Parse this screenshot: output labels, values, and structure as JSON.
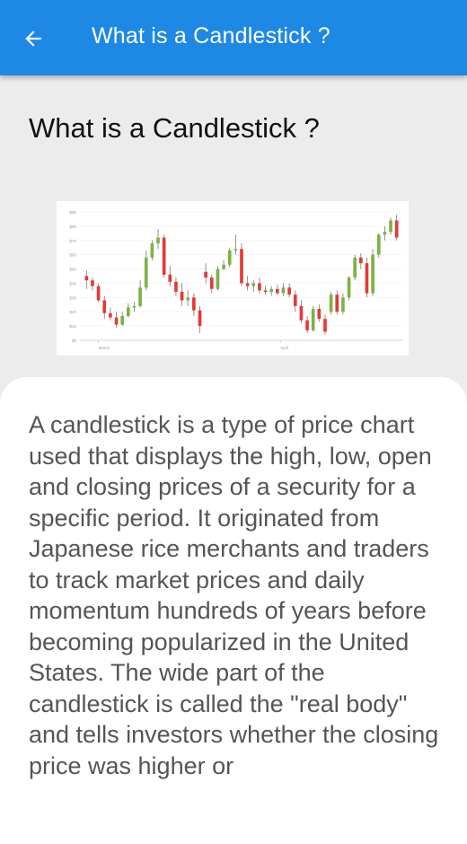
{
  "app_bar": {
    "back_icon": "arrow-back-icon",
    "title": "What is a Candlestick ?",
    "color": "#1e88e5"
  },
  "content": {
    "heading": "What is a Candlestick ?",
    "body": "A candlestick is a type of price chart used that displays the high, low, open and closing prices of a security for a specific period. It originated from Japanese rice merchants and traders to track market prices and daily momentum hundreds of years before becoming popularized in the United States. The wide part of the candlestick is called the \"real body\" and tells investors whether the closing price was higher or"
  },
  "chart_data": {
    "type": "candlestick",
    "y_ticks": [
      "$0",
      "$10",
      "$20",
      "$30",
      "$40",
      "$50",
      "$60",
      "$70",
      "$80",
      "$90"
    ],
    "x_labels": [
      "March",
      "April"
    ],
    "up_color": "#7cb342",
    "down_color": "#e53935",
    "candles": [
      {
        "o": 45,
        "h": 49,
        "l": 36,
        "c": 42
      },
      {
        "o": 42,
        "h": 44,
        "l": 35,
        "c": 38
      },
      {
        "o": 38,
        "h": 40,
        "l": 27,
        "c": 28
      },
      {
        "o": 28,
        "h": 31,
        "l": 15,
        "c": 19
      },
      {
        "o": 19,
        "h": 23,
        "l": 14,
        "c": 16
      },
      {
        "o": 16,
        "h": 20,
        "l": 9,
        "c": 11
      },
      {
        "o": 11,
        "h": 20,
        "l": 10,
        "c": 17
      },
      {
        "o": 17,
        "h": 26,
        "l": 16,
        "c": 23
      },
      {
        "o": 23,
        "h": 27,
        "l": 20,
        "c": 24
      },
      {
        "o": 24,
        "h": 42,
        "l": 23,
        "c": 37
      },
      {
        "o": 37,
        "h": 63,
        "l": 35,
        "c": 58
      },
      {
        "o": 58,
        "h": 70,
        "l": 56,
        "c": 68
      },
      {
        "o": 68,
        "h": 78,
        "l": 64,
        "c": 72
      },
      {
        "o": 72,
        "h": 74,
        "l": 44,
        "c": 46
      },
      {
        "o": 46,
        "h": 52,
        "l": 38,
        "c": 41
      },
      {
        "o": 41,
        "h": 44,
        "l": 31,
        "c": 34
      },
      {
        "o": 34,
        "h": 40,
        "l": 24,
        "c": 28
      },
      {
        "o": 28,
        "h": 35,
        "l": 24,
        "c": 30
      },
      {
        "o": 30,
        "h": 33,
        "l": 17,
        "c": 21
      },
      {
        "o": 21,
        "h": 24,
        "l": 5,
        "c": 10
      },
      {
        "o": 48,
        "h": 54,
        "l": 40,
        "c": 44
      },
      {
        "o": 44,
        "h": 46,
        "l": 33,
        "c": 36
      },
      {
        "o": 36,
        "h": 52,
        "l": 35,
        "c": 50
      },
      {
        "o": 50,
        "h": 56,
        "l": 49,
        "c": 53
      },
      {
        "o": 53,
        "h": 65,
        "l": 51,
        "c": 63
      },
      {
        "o": 63,
        "h": 74,
        "l": 60,
        "c": 64
      },
      {
        "o": 64,
        "h": 68,
        "l": 38,
        "c": 40
      },
      {
        "o": 40,
        "h": 45,
        "l": 35,
        "c": 38
      },
      {
        "o": 38,
        "h": 42,
        "l": 34,
        "c": 40
      },
      {
        "o": 40,
        "h": 44,
        "l": 33,
        "c": 35
      },
      {
        "o": 35,
        "h": 38,
        "l": 32,
        "c": 34
      },
      {
        "o": 34,
        "h": 38,
        "l": 31,
        "c": 36
      },
      {
        "o": 36,
        "h": 39,
        "l": 32,
        "c": 33
      },
      {
        "o": 33,
        "h": 40,
        "l": 31,
        "c": 37
      },
      {
        "o": 37,
        "h": 40,
        "l": 30,
        "c": 32
      },
      {
        "o": 32,
        "h": 35,
        "l": 20,
        "c": 24
      },
      {
        "o": 24,
        "h": 28,
        "l": 12,
        "c": 14
      },
      {
        "o": 14,
        "h": 17,
        "l": 5,
        "c": 7
      },
      {
        "o": 7,
        "h": 24,
        "l": 6,
        "c": 22
      },
      {
        "o": 22,
        "h": 25,
        "l": 13,
        "c": 15
      },
      {
        "o": 15,
        "h": 18,
        "l": 4,
        "c": 6
      },
      {
        "o": 20,
        "h": 34,
        "l": 18,
        "c": 32
      },
      {
        "o": 32,
        "h": 35,
        "l": 18,
        "c": 20
      },
      {
        "o": 20,
        "h": 33,
        "l": 18,
        "c": 30
      },
      {
        "o": 30,
        "h": 45,
        "l": 28,
        "c": 44
      },
      {
        "o": 44,
        "h": 60,
        "l": 42,
        "c": 58
      },
      {
        "o": 58,
        "h": 61,
        "l": 50,
        "c": 54
      },
      {
        "o": 54,
        "h": 58,
        "l": 30,
        "c": 33
      },
      {
        "o": 33,
        "h": 64,
        "l": 31,
        "c": 60
      },
      {
        "o": 60,
        "h": 75,
        "l": 58,
        "c": 74
      },
      {
        "o": 74,
        "h": 80,
        "l": 70,
        "c": 76
      },
      {
        "o": 76,
        "h": 86,
        "l": 74,
        "c": 84
      },
      {
        "o": 84,
        "h": 88,
        "l": 70,
        "c": 72
      }
    ]
  }
}
